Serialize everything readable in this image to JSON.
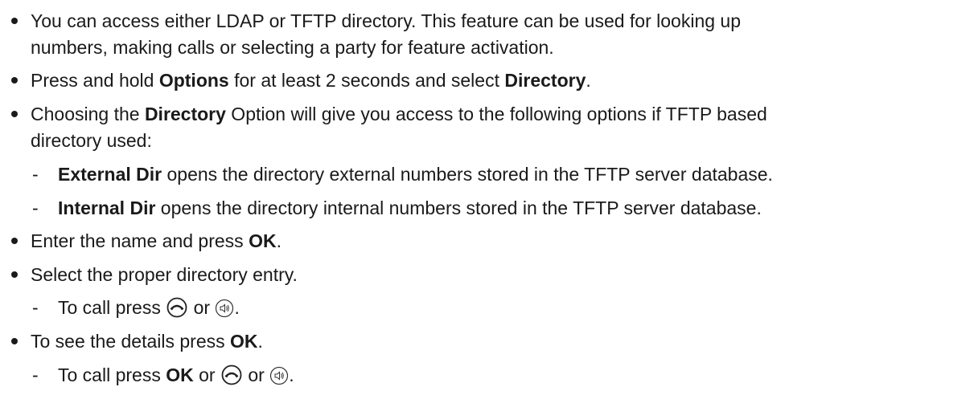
{
  "items": [
    {
      "line1": "You can access either LDAP or TFTP directory. This feature can be used for looking up",
      "line2": "numbers, making calls or selecting a party for feature activation."
    },
    {
      "pre": "Press and hold ",
      "b1": "Options",
      "mid": " for at least 2 seconds and select ",
      "b2": "Directory",
      "post": "."
    },
    {
      "pre": "Choosing the ",
      "b1": "Directory",
      "post": " Option will give you access to the following options if TFTP based",
      "line2": "directory used:",
      "subs": [
        {
          "bold": "External Dir",
          "text": " opens the directory external numbers stored in the TFTP server database."
        },
        {
          "bold": "Internal Dir",
          "text": " opens the directory internal numbers stored in the TFTP server database."
        }
      ]
    },
    {
      "pre": "Enter the name and press ",
      "b1": "OK",
      "post": "."
    },
    {
      "text": "Select the proper directory entry.",
      "sub": {
        "pre": "To call press ",
        "mid": " or ",
        "post": "."
      }
    },
    {
      "pre": "To see the details press ",
      "b1": "OK",
      "post": ".",
      "sub": {
        "pre": "To call press ",
        "b1": "OK",
        "mid": " or ",
        "mid2": " or ",
        "post": "."
      }
    }
  ],
  "dash_char": "-",
  "icons": [
    "handset-offhook-icon",
    "speaker-icon"
  ]
}
